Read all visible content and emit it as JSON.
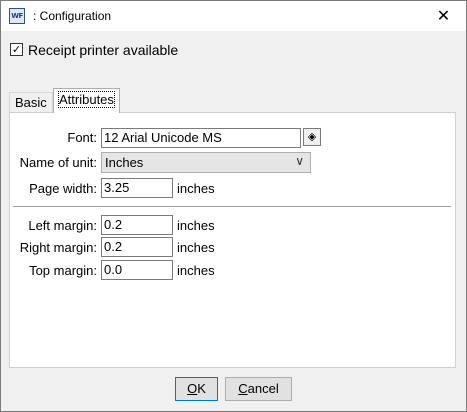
{
  "window": {
    "icon_text": "WF",
    "title": ": Configuration",
    "close_glyph": "✕"
  },
  "receipt_printer": {
    "checked": true,
    "check_glyph": "✓",
    "label": "Receipt printer available"
  },
  "tabs": [
    {
      "label": "Basic",
      "active": false
    },
    {
      "label": "Attributes",
      "active": true
    }
  ],
  "attributes": {
    "font": {
      "label": "Font:",
      "value": "12 Arial Unicode MS",
      "button_icon": "font-picker-icon",
      "button_glyph": "◈"
    },
    "unit_name": {
      "label": "Name of unit:",
      "value": "Inches",
      "arrow": "∨"
    },
    "page_width": {
      "label": "Page width:",
      "value": "3.25",
      "unit": "inches"
    },
    "left_margin": {
      "label": "Left margin:",
      "value": "0.2",
      "unit": "inches"
    },
    "right_margin": {
      "label": "Right margin:",
      "value": "0.2",
      "unit": "inches"
    },
    "top_margin": {
      "label": "Top margin:",
      "value": "0.0",
      "unit": "inches"
    }
  },
  "buttons": {
    "ok": {
      "underlined": "O",
      "rest": "K"
    },
    "cancel": {
      "underlined": "C",
      "rest": "ancel"
    }
  }
}
